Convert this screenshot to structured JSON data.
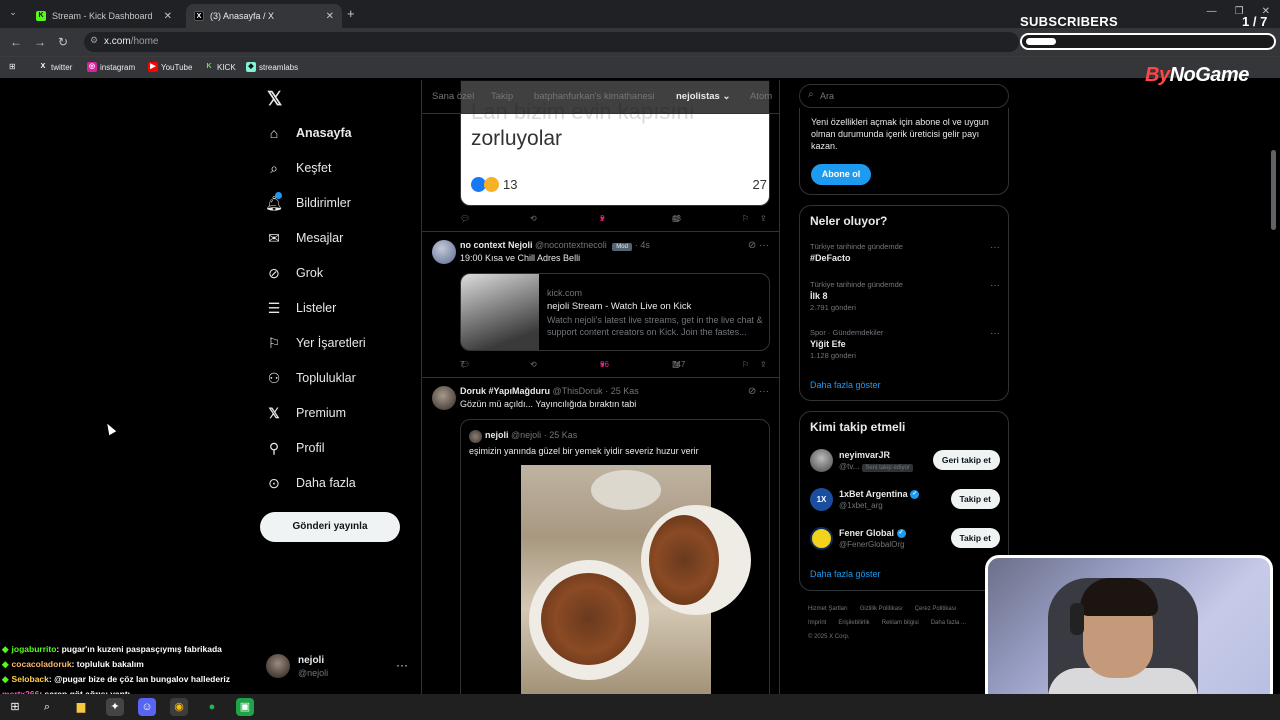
{
  "browser": {
    "tabs": [
      {
        "title": "Stream - Kick Dashboard",
        "icon": "kick-icon",
        "active": false
      },
      {
        "title": "(3) Anasayfa / X",
        "icon": "x-icon",
        "active": true
      }
    ],
    "url_host": "x.com",
    "url_path": "/home",
    "bookmarks": [
      {
        "label": "twitter",
        "icon": "x-icon"
      },
      {
        "label": "instagram",
        "icon": "instagram-icon"
      },
      {
        "label": "YouTube",
        "icon": "youtube-icon"
      },
      {
        "label": "KICK",
        "icon": "kick-icon"
      },
      {
        "label": "streamlabs",
        "icon": "streamlabs-icon"
      }
    ]
  },
  "overlay": {
    "subscribers_label": "SUBSCRIBERS",
    "subscribers_count": "1 / 7",
    "brand_by": "By",
    "brand_name": "NoGame",
    "chat": [
      {
        "user": "jogaburrito",
        "color": "#53fc18",
        "msg": ": pugar'ın kuzeni paspasçıymış fabrikada"
      },
      {
        "user": "cocacoladoruk",
        "color": "#ffb86b",
        "msg": ": topluluk bakalım"
      },
      {
        "user": "Seloback",
        "color": "#ffd34d",
        "msg": ": @pugar bize de çöz lan bungalov hallederiz"
      },
      {
        "user": "mertx266",
        "color": "#ff5cc8",
        "msg": ": şarap göt ağrısı yaptı"
      }
    ]
  },
  "sidebar": {
    "items": [
      {
        "label": "Anasayfa",
        "icon": "home-icon",
        "bold": true
      },
      {
        "label": "Keşfet",
        "icon": "search-icon"
      },
      {
        "label": "Bildirimler",
        "icon": "bell-icon"
      },
      {
        "label": "Mesajlar",
        "icon": "mail-icon"
      },
      {
        "label": "Grok",
        "icon": "grok-icon"
      },
      {
        "label": "Listeler",
        "icon": "list-icon"
      },
      {
        "label": "Yer İşaretleri",
        "icon": "bookmark-icon"
      },
      {
        "label": "Topluluklar",
        "icon": "communities-icon"
      },
      {
        "label": "Premium",
        "icon": "x-icon"
      },
      {
        "label": "Profil",
        "icon": "person-icon"
      },
      {
        "label": "Daha fazla",
        "icon": "more-icon"
      }
    ],
    "post_button": "Gönderi yayınla",
    "account": {
      "name": "nejoli",
      "handle": "@nejoli"
    }
  },
  "timeline": {
    "tabs": [
      "Sana özel",
      "Takip",
      "batphanfurkan's kimathanesi",
      "nejolistas",
      "Atom"
    ],
    "active_tab": "nejolistas",
    "top_quote": {
      "line1": "Lan bizim evin kapısını",
      "line2": "zorluyolar",
      "reaction_count": "13",
      "reaction_right": "27"
    },
    "top_actions": {
      "replies": "",
      "reposts": "",
      "likes": "2",
      "views": "43"
    },
    "tweets": [
      {
        "name": "no context Nejoli",
        "handle": "@nocontextnecoli",
        "mod": "Mod",
        "time": "· 4s",
        "text": "19:00 Kısa ve Chill Adres Belli",
        "card": {
          "domain": "kick.com",
          "title": "nejoli Stream - Watch Live on Kick",
          "desc": "Watch nejoli's latest live streams, get in the live chat & support content creators on Kick. Join the fastes..."
        },
        "actions": {
          "replies": "7",
          "reposts": "",
          "likes": "36",
          "views": "747"
        }
      },
      {
        "name": "Doruk #YapıMağduru",
        "handle": "@ThisDoruk",
        "time": "· 25 Kas",
        "text": "Gözün mü açıldı... Yayıncılığıda bıraktın tabi",
        "quote": {
          "name": "nejoli",
          "handle": "@nejoli",
          "time": "· 25 Kas",
          "text": "eşimizin yanında güzel bir yemek iyidir severiz huzur verir"
        }
      }
    ]
  },
  "right": {
    "search_placeholder": "Ara",
    "premium": {
      "text": "Yeni özellikleri açmak için abone ol ve uygun olman durumunda içerik üreticisi gelir payı kazan.",
      "button": "Abone ol"
    },
    "trends": {
      "title": "Neler oluyor?",
      "items": [
        {
          "context": "Türkiye tarihinde gündemde",
          "topic": "#DeFacto",
          "posts": ""
        },
        {
          "context": "Türkiye tarihinde gündemde",
          "topic": "İlk 8",
          "posts": "2.791 gönderi"
        },
        {
          "context": "Spor · Gündemdekiler",
          "topic": "Yiğit Efe",
          "posts": "1.128 gönderi"
        }
      ],
      "show_more": "Daha fazla göster"
    },
    "who_to_follow": {
      "title": "Kimi takip etmeli",
      "items": [
        {
          "name": "neyimvarJR",
          "handle": "@tv...",
          "follows_you": "Seni takip ediyor",
          "button": "Geri takip et",
          "verified": false,
          "avatar_color": "#555555"
        },
        {
          "name": "1xBet Argentina",
          "handle": "@1xbet_arg",
          "follows_you": "",
          "button": "Takip et",
          "verified": true,
          "avatar_color": "#1a4fa0"
        },
        {
          "name": "Fener Global",
          "handle": "@FenerGlobalOrg",
          "follows_you": "",
          "button": "Takip et",
          "verified": true,
          "avatar_color": "#f2d21c"
        }
      ],
      "show_more": "Daha fazla göster"
    },
    "footer": [
      "Hizmet Şartları",
      "Gizlilik Politikası",
      "Çerez Politikası",
      "Imprint",
      "Erişilebilirlik",
      "Reklam bilgisi",
      "Daha fazla ...",
      "© 2025 X Corp."
    ]
  }
}
